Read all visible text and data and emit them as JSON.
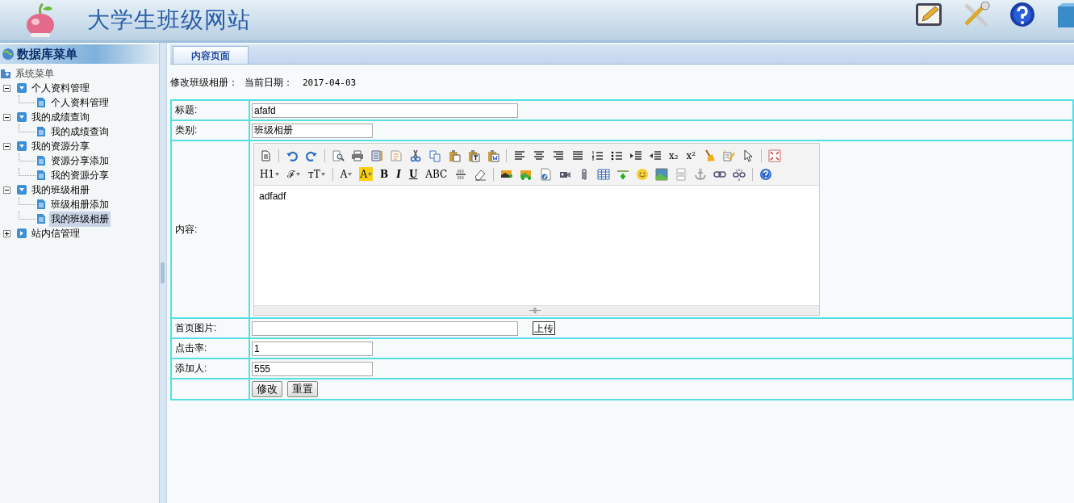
{
  "header": {
    "title": "大学生班级网站"
  },
  "sidebar": {
    "title": "数据库菜单",
    "tree": [
      {
        "label": "系统菜单",
        "children": [
          {
            "label": "个人资料管理",
            "expanded": true,
            "children": [
              {
                "label": "个人资料管理",
                "selected": false
              }
            ]
          },
          {
            "label": "我的成绩查询",
            "expanded": true,
            "children": [
              {
                "label": "我的成绩查询",
                "selected": false
              }
            ]
          },
          {
            "label": "我的资源分享",
            "expanded": true,
            "children": [
              {
                "label": "资源分享添加",
                "selected": false
              },
              {
                "label": "我的资源分享",
                "selected": false
              }
            ]
          },
          {
            "label": "我的班级相册",
            "expanded": true,
            "children": [
              {
                "label": "班级相册添加",
                "selected": false
              },
              {
                "label": "我的班级相册",
                "selected": true
              }
            ]
          },
          {
            "label": "站内信管理",
            "expanded": false
          }
        ]
      }
    ]
  },
  "tabs": [
    {
      "label": "内容页面",
      "selected": true
    }
  ],
  "page_heading": "修改班级相册：",
  "date_label": "当前日期：",
  "date": "2017-04-03",
  "form": {
    "rows": [
      {
        "kind": "wide_text",
        "label": "标题:",
        "value": "afafd"
      },
      {
        "kind": "text",
        "label": "类别:",
        "value": "班级相册"
      },
      {
        "kind": "editor",
        "label": "内容:",
        "value": "adfadf"
      },
      {
        "kind": "upload",
        "label": "首页图片:",
        "value": "",
        "button": "上传"
      },
      {
        "kind": "text",
        "label": "点击率:",
        "value": "1"
      },
      {
        "kind": "text",
        "label": "添加人:",
        "value": "555"
      },
      {
        "kind": "buttons",
        "label": "",
        "buttons": [
          "修改",
          "重置"
        ]
      }
    ]
  },
  "editor_toolbar": [
    [
      {
        "kind": "icon"
      },
      {
        "kind": "separator"
      },
      {
        "kind": "icon"
      },
      {
        "kind": "icon"
      },
      {
        "kind": "separator"
      },
      {
        "kind": "icon"
      },
      {
        "kind": "icon"
      },
      {
        "kind": "icon"
      },
      {
        "kind": "icon"
      },
      {
        "kind": "icon"
      },
      {
        "kind": "icon"
      },
      {
        "kind": "icon"
      },
      {
        "kind": "icon"
      },
      {
        "kind": "icon"
      },
      {
        "kind": "separator"
      },
      {
        "kind": "icon"
      },
      {
        "kind": "icon"
      },
      {
        "kind": "icon"
      },
      {
        "kind": "icon"
      },
      {
        "kind": "icon"
      },
      {
        "kind": "icon"
      },
      {
        "kind": "icon"
      },
      {
        "kind": "icon"
      },
      {
        "kind": "glyph",
        "label": "x₂"
      },
      {
        "kind": "glyph",
        "label": "x²"
      },
      {
        "kind": "icon"
      },
      {
        "kind": "icon"
      },
      {
        "kind": "icon"
      },
      {
        "kind": "separator"
      },
      {
        "kind": "icon"
      }
    ],
    [
      {
        "kind": "glyph",
        "label": "H1",
        "dropdown": true
      },
      {
        "kind": "glyph",
        "label": "ℱ",
        "dropdown": true
      },
      {
        "kind": "glyph",
        "label": "тT",
        "dropdown": true
      },
      {
        "kind": "separator"
      },
      {
        "kind": "glyph",
        "label": "A",
        "dropdown": true
      },
      {
        "kind": "glyph",
        "label": "A",
        "dropdown": true,
        "highlight": true
      },
      {
        "kind": "bold",
        "label": "B"
      },
      {
        "kind": "italic",
        "label": "I"
      },
      {
        "kind": "underline",
        "label": "U"
      },
      {
        "kind": "glyph",
        "label": "ABC"
      },
      {
        "kind": "icon"
      },
      {
        "kind": "icon"
      },
      {
        "kind": "separator"
      },
      {
        "kind": "icon"
      },
      {
        "kind": "icon"
      },
      {
        "kind": "icon"
      },
      {
        "kind": "icon"
      },
      {
        "kind": "icon"
      },
      {
        "kind": "icon"
      },
      {
        "kind": "icon"
      },
      {
        "kind": "icon"
      },
      {
        "kind": "icon"
      },
      {
        "kind": "icon"
      },
      {
        "kind": "icon"
      },
      {
        "kind": "icon"
      },
      {
        "kind": "icon"
      },
      {
        "kind": "separator"
      },
      {
        "kind": "icon"
      }
    ]
  ]
}
